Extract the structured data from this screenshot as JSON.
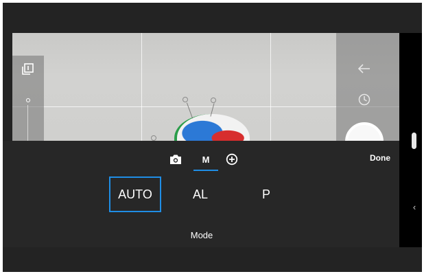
{
  "icons": {
    "gallery": "gallery-icon",
    "back": "back-arrow-icon",
    "history": "clock-icon",
    "shutter": "shutter-button",
    "photo_tab": "camera-icon",
    "plus_tab": "plus-circle-icon",
    "collapse": "chevron-left-icon"
  },
  "tabs": {
    "manual_label": "M"
  },
  "toolbar": {
    "done_label": "Done"
  },
  "modes": {
    "options": [
      "AUTO",
      "AL",
      "P"
    ],
    "selected": "AUTO",
    "label": "Mode"
  },
  "colors": {
    "accent": "#1f8ee6",
    "panel": "#272727",
    "background": "#232323"
  }
}
